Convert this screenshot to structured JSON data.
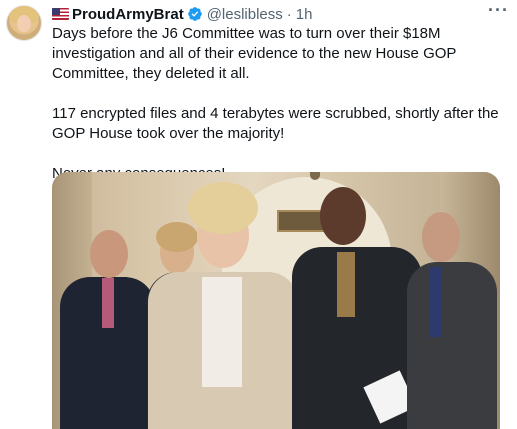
{
  "author": {
    "display_name": "ProudArmyBrat",
    "handle": "@leslibless",
    "time": "1h",
    "separator": "·",
    "flag": "us-flag-icon",
    "verified_icon": "verified-badge-icon"
  },
  "more_label": "···",
  "tweet": {
    "paragraphs": [
      "Days before the J6 Committee was to turn over their $18M investigation and all of their evidence to the new House GOP Committee, they deleted it all.",
      "117 encrypted files and 4 terabytes were scrubbed, shortly after the GOP House took over the majority!",
      "Never any consequences!"
    ]
  },
  "colors": {
    "text": "#0f1419",
    "secondary": "#536471",
    "verified": "#1d9bf0"
  }
}
